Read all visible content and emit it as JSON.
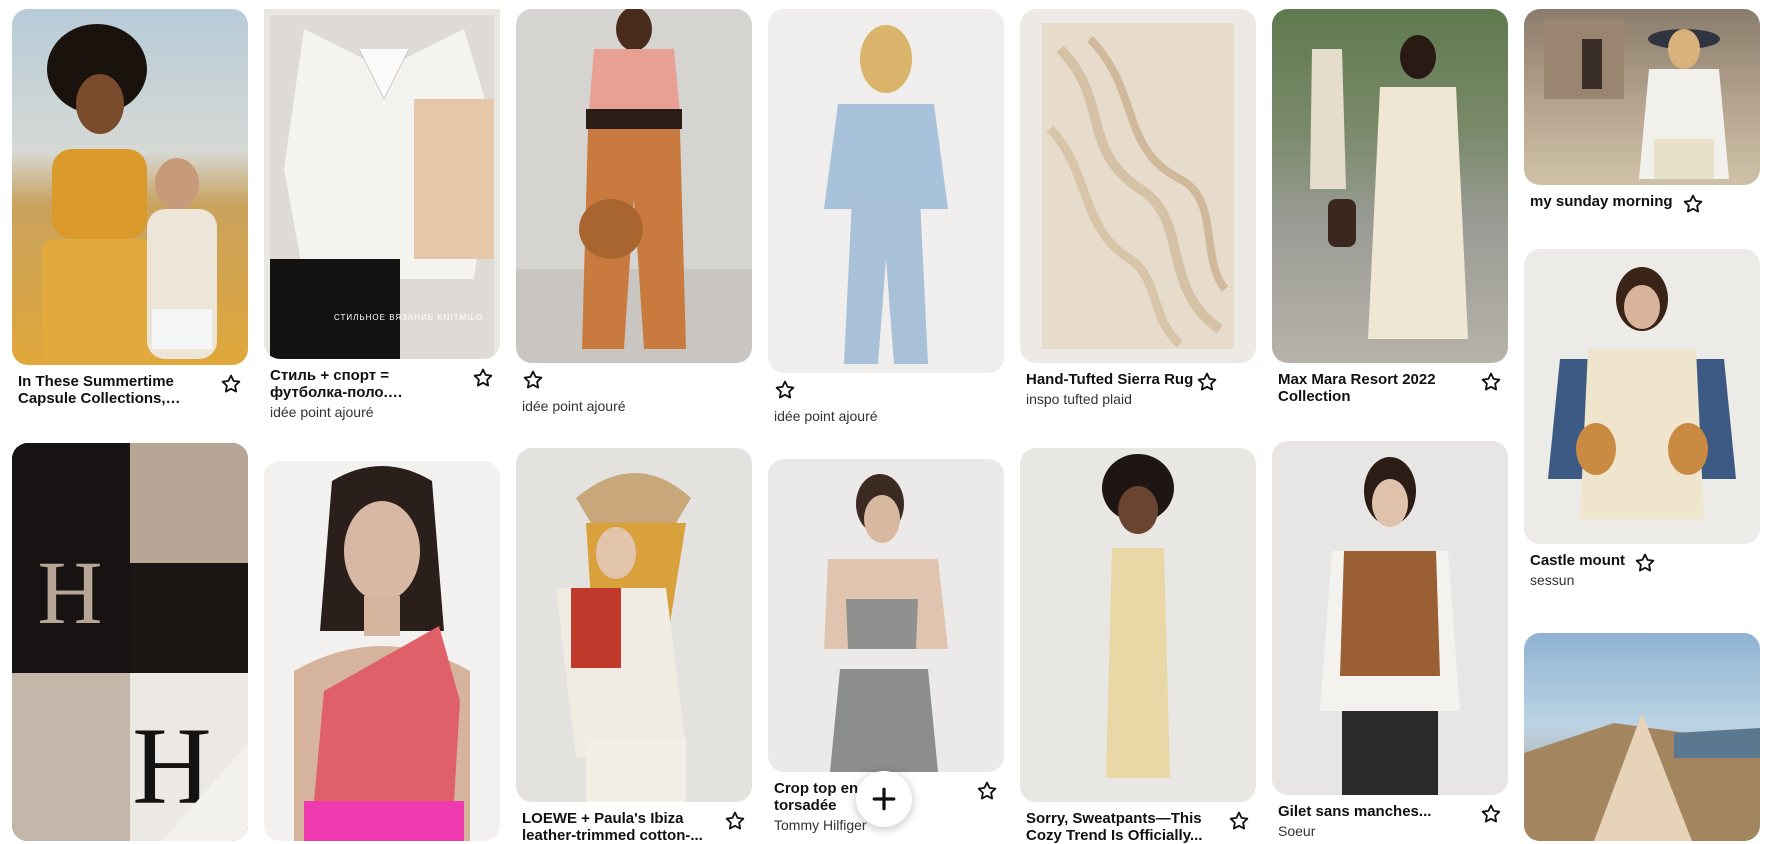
{
  "pins": [
    {
      "id": "p1",
      "title": "In These Summertime Capsule Collections, the...",
      "subtitle": ""
    },
    {
      "id": "p2",
      "title": "Стиль + спорт = футболка-поло. История создания,...",
      "subtitle": "idée point ajouré",
      "overlay_text": "СТИЛЬНОЕ ВЯЗАНИЕ KNITMILO"
    },
    {
      "id": "p3",
      "title": "",
      "subtitle": "idée point ajouré"
    },
    {
      "id": "p4",
      "title": "",
      "subtitle": "idée point ajouré"
    },
    {
      "id": "p5",
      "title": "Hand-Tufted Sierra Rug",
      "subtitle": "inspo tufted plaid"
    },
    {
      "id": "p6",
      "title": "Max Mara Resort 2022 Collection",
      "subtitle": ""
    },
    {
      "id": "p7",
      "title": "my sunday morning",
      "subtitle": ""
    },
    {
      "id": "p8",
      "title": "Castle mount",
      "subtitle": "sessun"
    },
    {
      "id": "p9",
      "title": "",
      "subtitle": ""
    },
    {
      "id": "p10",
      "title": "",
      "subtitle": ""
    },
    {
      "id": "p11",
      "title": "LOEWE + Paula's Ibiza leather-trimmed cotton-...",
      "subtitle": ""
    },
    {
      "id": "p12",
      "title": "Crop top en maille torsadée",
      "subtitle": "Tommy Hilfiger"
    },
    {
      "id": "p13",
      "title": "Sorry, Sweatpants—This Cozy Trend Is Officially...",
      "subtitle": ""
    },
    {
      "id": "p14",
      "title": "Gilet sans manches...",
      "subtitle": "Soeur"
    },
    {
      "id": "p15",
      "title": "",
      "subtitle": ""
    }
  ],
  "icons": {
    "save": "star-outline-icon",
    "add": "plus-icon"
  },
  "colors": {
    "background": "#ffffff",
    "text": "#111111",
    "subtext": "#333333"
  }
}
